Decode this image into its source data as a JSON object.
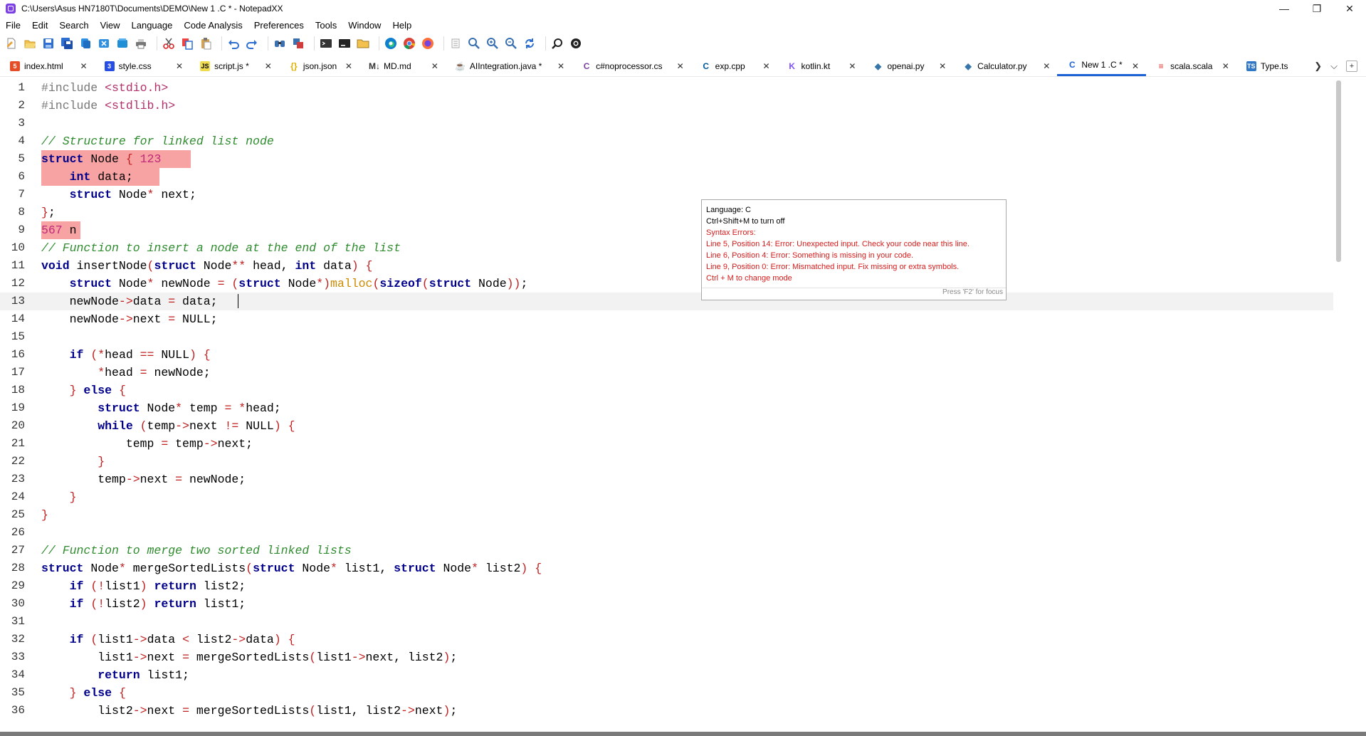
{
  "window": {
    "title": "C:\\Users\\Asus HN7180T\\Documents\\DEMO\\New 1 .C * - NotepadXX",
    "minimize": "—",
    "restore": "❐",
    "close": "✕"
  },
  "menu": [
    "File",
    "Edit",
    "Search",
    "View",
    "Language",
    "Code Analysis",
    "Preferences",
    "Tools",
    "Window",
    "Help"
  ],
  "tabs": [
    {
      "label": "index.html",
      "icon": "html-icon",
      "glyph": "5",
      "color": "#e44d26",
      "modified": false
    },
    {
      "label": "style.css",
      "icon": "css-icon",
      "glyph": "3",
      "color": "#264de4",
      "modified": false
    },
    {
      "label": "script.js *",
      "icon": "js-icon",
      "glyph": "JS",
      "color": "#f0db4f",
      "modified": true
    },
    {
      "label": "json.json",
      "icon": "json-icon",
      "glyph": "{}",
      "color": "#e0b000",
      "modified": false
    },
    {
      "label": "MD.md",
      "icon": "markdown-icon",
      "glyph": "M↓",
      "color": "#333333",
      "modified": false
    },
    {
      "label": "AIIntegration.java *",
      "icon": "java-icon",
      "glyph": "☕",
      "color": "#5382a1",
      "modified": true
    },
    {
      "label": "c#noprocessor.cs",
      "icon": "csharp-icon",
      "glyph": "C",
      "color": "#7b3fa0",
      "modified": false
    },
    {
      "label": "exp.cpp",
      "icon": "cpp-icon",
      "glyph": "C",
      "color": "#00599c",
      "modified": false
    },
    {
      "label": "kotlin.kt",
      "icon": "kotlin-icon",
      "glyph": "K",
      "color": "#7f52ff",
      "modified": false
    },
    {
      "label": "openai.py",
      "icon": "python-icon",
      "glyph": "◆",
      "color": "#3776ab",
      "modified": false
    },
    {
      "label": "Calculator.py",
      "icon": "python-icon",
      "glyph": "◆",
      "color": "#3776ab",
      "modified": false
    },
    {
      "label": "New 1 .C *",
      "icon": "c-icon",
      "glyph": "C",
      "color": "#1e63d6",
      "modified": true,
      "active": true
    },
    {
      "label": "scala.scala",
      "icon": "scala-icon",
      "glyph": "≡",
      "color": "#dc322f",
      "modified": false
    },
    {
      "label": "Type.ts",
      "icon": "typescript-icon",
      "glyph": "TS",
      "color": "#3178c6",
      "modified": false
    }
  ],
  "editor": {
    "current_line": 13,
    "lines": [
      "#include <stdio.h>",
      "#include <stdlib.h>",
      "",
      "// Structure for linked list node",
      "struct Node { 123",
      "    int data;",
      "    struct Node* next;",
      "};",
      "567 n",
      "// Function to insert a node at the end of the list",
      "void insertNode(struct Node** head, int data) {",
      "    struct Node* newNode = (struct Node*)malloc(sizeof(struct Node));",
      "    newNode->data = data;",
      "    newNode->next = NULL;",
      "",
      "    if (*head == NULL) {",
      "        *head = newNode;",
      "    } else {",
      "        struct Node* temp = *head;",
      "        while (temp->next != NULL) {",
      "            temp = temp->next;",
      "        }",
      "        temp->next = newNode;",
      "    }",
      "}",
      "",
      "// Function to merge two sorted linked lists",
      "struct Node* mergeSortedLists(struct Node* list1, struct Node* list2) {",
      "    if (!list1) return list2;",
      "    if (!list2) return list1;",
      "",
      "    if (list1->data < list2->data) {",
      "        list1->next = mergeSortedLists(list1->next, list2);",
      "        return list1;",
      "    } else {",
      "        list2->next = mergeSortedLists(list1, list2->next);"
    ]
  },
  "tooltip": {
    "language": "Language: C",
    "toggle_hint": "Ctrl+Shift+M to turn off",
    "errors_title": "Syntax Errors:",
    "errors": [
      "Line 5, Position 14: Error: Unexpected input. Check your code near this line.",
      "Line 6, Position 4: Error: Something is missing in your code.",
      "Line 9, Position 0: Error: Mismatched input. Fix missing or extra symbols."
    ],
    "mode_hint": "Ctrl + M to change mode",
    "focus_hint": "Press 'F2' for focus"
  },
  "colors": {
    "keyword": "#00008b",
    "comment": "#2e8b2e",
    "error_highlight": "#f7a3a3",
    "error_text": "#d81b1b",
    "active_tab": "#1e63d6"
  }
}
